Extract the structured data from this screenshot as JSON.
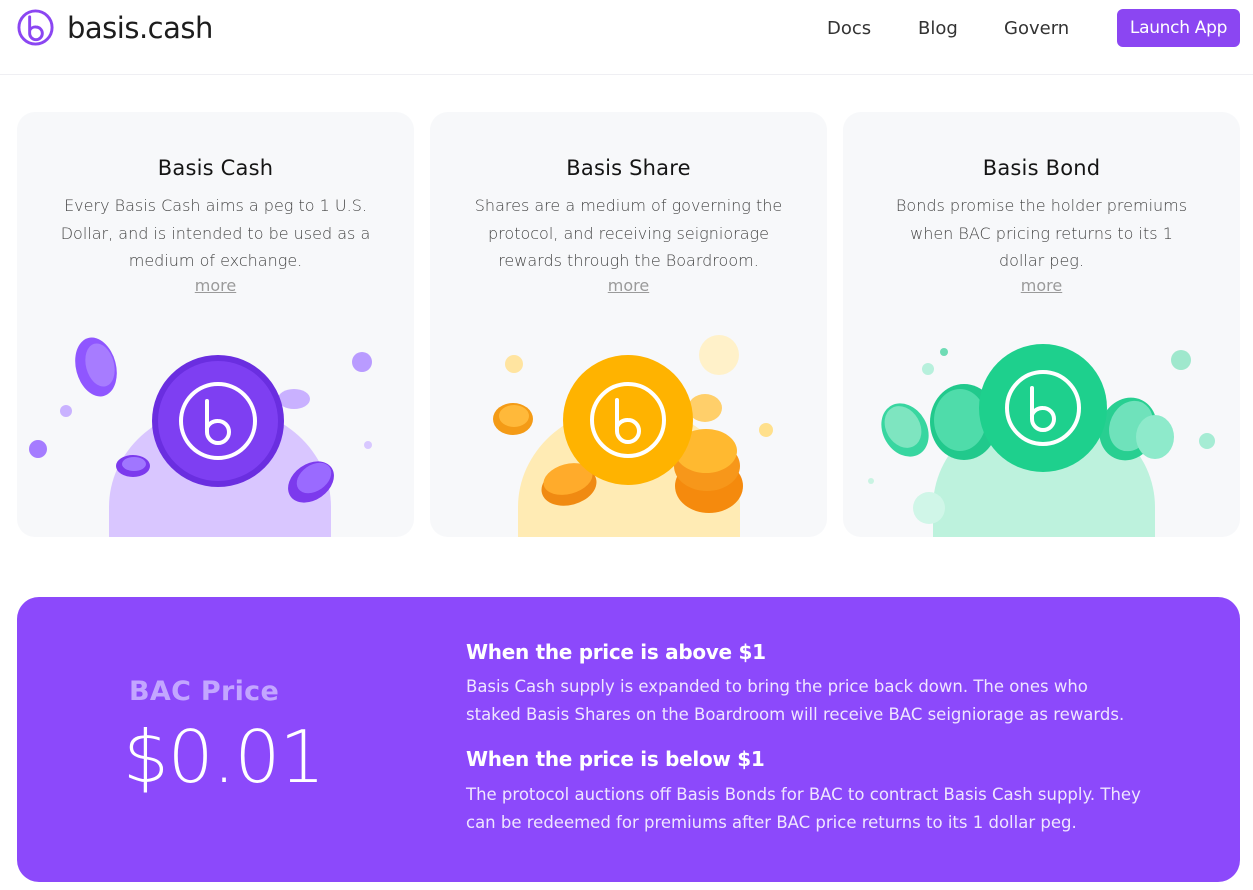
{
  "header": {
    "brand": "basis.cash",
    "nav": {
      "docs": "Docs",
      "blog": "Blog",
      "govern": "Govern"
    },
    "launch_label": "Launch App"
  },
  "cards": [
    {
      "title": "Basis Cash",
      "description": "Every Basis Cash aims a peg to 1 U.S. Dollar, and is intended to be used as a medium of exchange.",
      "more": "more",
      "icon": "purple-coin-icon"
    },
    {
      "title": "Basis Share",
      "description": "Shares are a medium of governing the protocol, and receiving seigniorage rewards through the Boardroom.",
      "more": "more",
      "icon": "orange-coin-icon"
    },
    {
      "title": "Basis Bond",
      "description": "Bonds promise the holder premiums when BAC pricing returns to its 1 dollar peg.",
      "more": "more",
      "icon": "green-coin-icon"
    }
  ],
  "price": {
    "label": "BAC Price",
    "value": "$0.01",
    "above_title": "When the price is above $1",
    "above_text": "Basis Cash supply is expanded to bring the price back down. The ones who staked Basis Shares on the Boardroom will receive BAC seigniorage as rewards.",
    "below_title": "When the price is below $1",
    "below_text": "The protocol auctions off Basis Bonds for BAC to contract Basis Cash supply. They can be redeemed for premiums after BAC price returns to its 1 dollar peg."
  },
  "colors": {
    "accent": "#8b46f2",
    "banner": "#8c49fb",
    "cash": "#7c3aed",
    "share": "#ffb020",
    "bond": "#22d69a"
  }
}
